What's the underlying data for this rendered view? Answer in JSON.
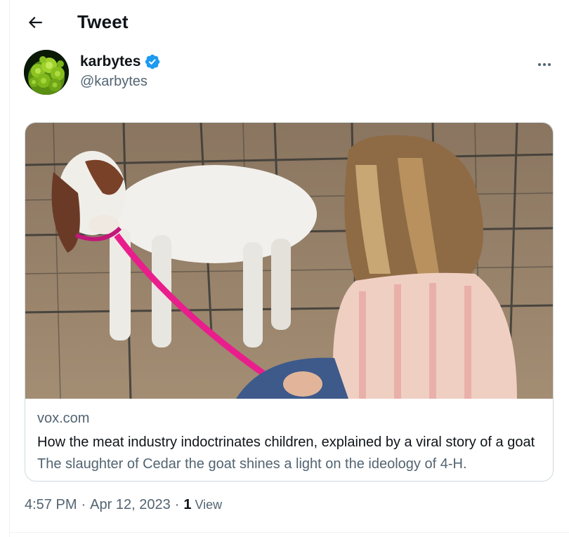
{
  "header": {
    "title": "Tweet",
    "back_icon": "arrow-left-icon"
  },
  "author": {
    "display_name": "karbytes",
    "handle": "@karbytes",
    "verified_icon": "verified-badge-icon",
    "avatar_icon": "romanesco-avatar",
    "more_icon": "more-horizontal-icon"
  },
  "card": {
    "domain": "vox.com",
    "title": "How the meat industry indoctrinates children, explained by a viral story of a goat",
    "description": "The slaughter of Cedar the goat shines a light on the ideology of 4-H."
  },
  "meta": {
    "time": "4:57 PM",
    "separator": "·",
    "date": "Apr 12, 2023",
    "separator2": "·",
    "views_count": "1",
    "views_label": "View"
  },
  "colors": {
    "accent": "#1d9bf0",
    "text_primary": "#0f1419",
    "text_secondary": "#536471",
    "border": "#cfd9de"
  }
}
